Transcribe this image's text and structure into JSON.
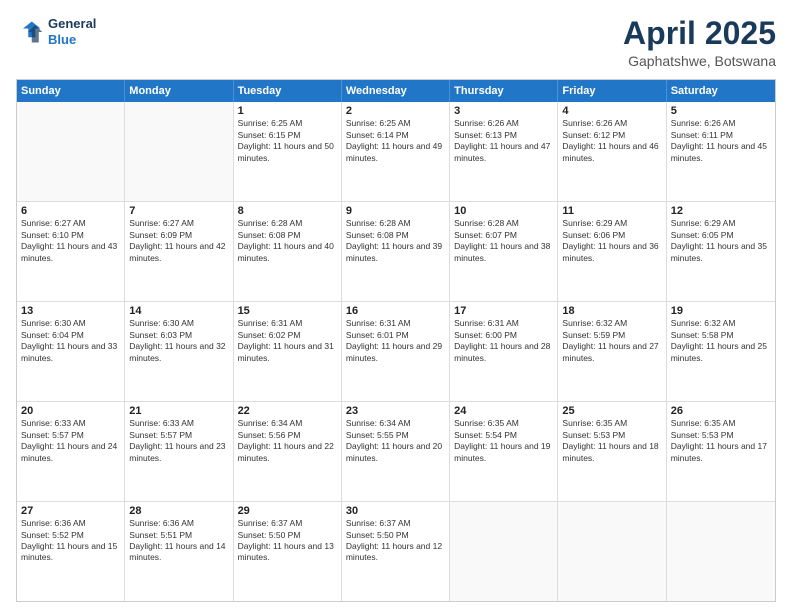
{
  "logo": {
    "line1": "General",
    "line2": "Blue"
  },
  "title": "April 2025",
  "subtitle": "Gaphatshwe, Botswana",
  "header_days": [
    "Sunday",
    "Monday",
    "Tuesday",
    "Wednesday",
    "Thursday",
    "Friday",
    "Saturday"
  ],
  "rows": [
    [
      {
        "day": "",
        "text": ""
      },
      {
        "day": "",
        "text": ""
      },
      {
        "day": "1",
        "text": "Sunrise: 6:25 AM\nSunset: 6:15 PM\nDaylight: 11 hours and 50 minutes."
      },
      {
        "day": "2",
        "text": "Sunrise: 6:25 AM\nSunset: 6:14 PM\nDaylight: 11 hours and 49 minutes."
      },
      {
        "day": "3",
        "text": "Sunrise: 6:26 AM\nSunset: 6:13 PM\nDaylight: 11 hours and 47 minutes."
      },
      {
        "day": "4",
        "text": "Sunrise: 6:26 AM\nSunset: 6:12 PM\nDaylight: 11 hours and 46 minutes."
      },
      {
        "day": "5",
        "text": "Sunrise: 6:26 AM\nSunset: 6:11 PM\nDaylight: 11 hours and 45 minutes."
      }
    ],
    [
      {
        "day": "6",
        "text": "Sunrise: 6:27 AM\nSunset: 6:10 PM\nDaylight: 11 hours and 43 minutes."
      },
      {
        "day": "7",
        "text": "Sunrise: 6:27 AM\nSunset: 6:09 PM\nDaylight: 11 hours and 42 minutes."
      },
      {
        "day": "8",
        "text": "Sunrise: 6:28 AM\nSunset: 6:08 PM\nDaylight: 11 hours and 40 minutes."
      },
      {
        "day": "9",
        "text": "Sunrise: 6:28 AM\nSunset: 6:08 PM\nDaylight: 11 hours and 39 minutes."
      },
      {
        "day": "10",
        "text": "Sunrise: 6:28 AM\nSunset: 6:07 PM\nDaylight: 11 hours and 38 minutes."
      },
      {
        "day": "11",
        "text": "Sunrise: 6:29 AM\nSunset: 6:06 PM\nDaylight: 11 hours and 36 minutes."
      },
      {
        "day": "12",
        "text": "Sunrise: 6:29 AM\nSunset: 6:05 PM\nDaylight: 11 hours and 35 minutes."
      }
    ],
    [
      {
        "day": "13",
        "text": "Sunrise: 6:30 AM\nSunset: 6:04 PM\nDaylight: 11 hours and 33 minutes."
      },
      {
        "day": "14",
        "text": "Sunrise: 6:30 AM\nSunset: 6:03 PM\nDaylight: 11 hours and 32 minutes."
      },
      {
        "day": "15",
        "text": "Sunrise: 6:31 AM\nSunset: 6:02 PM\nDaylight: 11 hours and 31 minutes."
      },
      {
        "day": "16",
        "text": "Sunrise: 6:31 AM\nSunset: 6:01 PM\nDaylight: 11 hours and 29 minutes."
      },
      {
        "day": "17",
        "text": "Sunrise: 6:31 AM\nSunset: 6:00 PM\nDaylight: 11 hours and 28 minutes."
      },
      {
        "day": "18",
        "text": "Sunrise: 6:32 AM\nSunset: 5:59 PM\nDaylight: 11 hours and 27 minutes."
      },
      {
        "day": "19",
        "text": "Sunrise: 6:32 AM\nSunset: 5:58 PM\nDaylight: 11 hours and 25 minutes."
      }
    ],
    [
      {
        "day": "20",
        "text": "Sunrise: 6:33 AM\nSunset: 5:57 PM\nDaylight: 11 hours and 24 minutes."
      },
      {
        "day": "21",
        "text": "Sunrise: 6:33 AM\nSunset: 5:57 PM\nDaylight: 11 hours and 23 minutes."
      },
      {
        "day": "22",
        "text": "Sunrise: 6:34 AM\nSunset: 5:56 PM\nDaylight: 11 hours and 22 minutes."
      },
      {
        "day": "23",
        "text": "Sunrise: 6:34 AM\nSunset: 5:55 PM\nDaylight: 11 hours and 20 minutes."
      },
      {
        "day": "24",
        "text": "Sunrise: 6:35 AM\nSunset: 5:54 PM\nDaylight: 11 hours and 19 minutes."
      },
      {
        "day": "25",
        "text": "Sunrise: 6:35 AM\nSunset: 5:53 PM\nDaylight: 11 hours and 18 minutes."
      },
      {
        "day": "26",
        "text": "Sunrise: 6:35 AM\nSunset: 5:53 PM\nDaylight: 11 hours and 17 minutes."
      }
    ],
    [
      {
        "day": "27",
        "text": "Sunrise: 6:36 AM\nSunset: 5:52 PM\nDaylight: 11 hours and 15 minutes."
      },
      {
        "day": "28",
        "text": "Sunrise: 6:36 AM\nSunset: 5:51 PM\nDaylight: 11 hours and 14 minutes."
      },
      {
        "day": "29",
        "text": "Sunrise: 6:37 AM\nSunset: 5:50 PM\nDaylight: 11 hours and 13 minutes."
      },
      {
        "day": "30",
        "text": "Sunrise: 6:37 AM\nSunset: 5:50 PM\nDaylight: 11 hours and 12 minutes."
      },
      {
        "day": "",
        "text": ""
      },
      {
        "day": "",
        "text": ""
      },
      {
        "day": "",
        "text": ""
      }
    ]
  ]
}
